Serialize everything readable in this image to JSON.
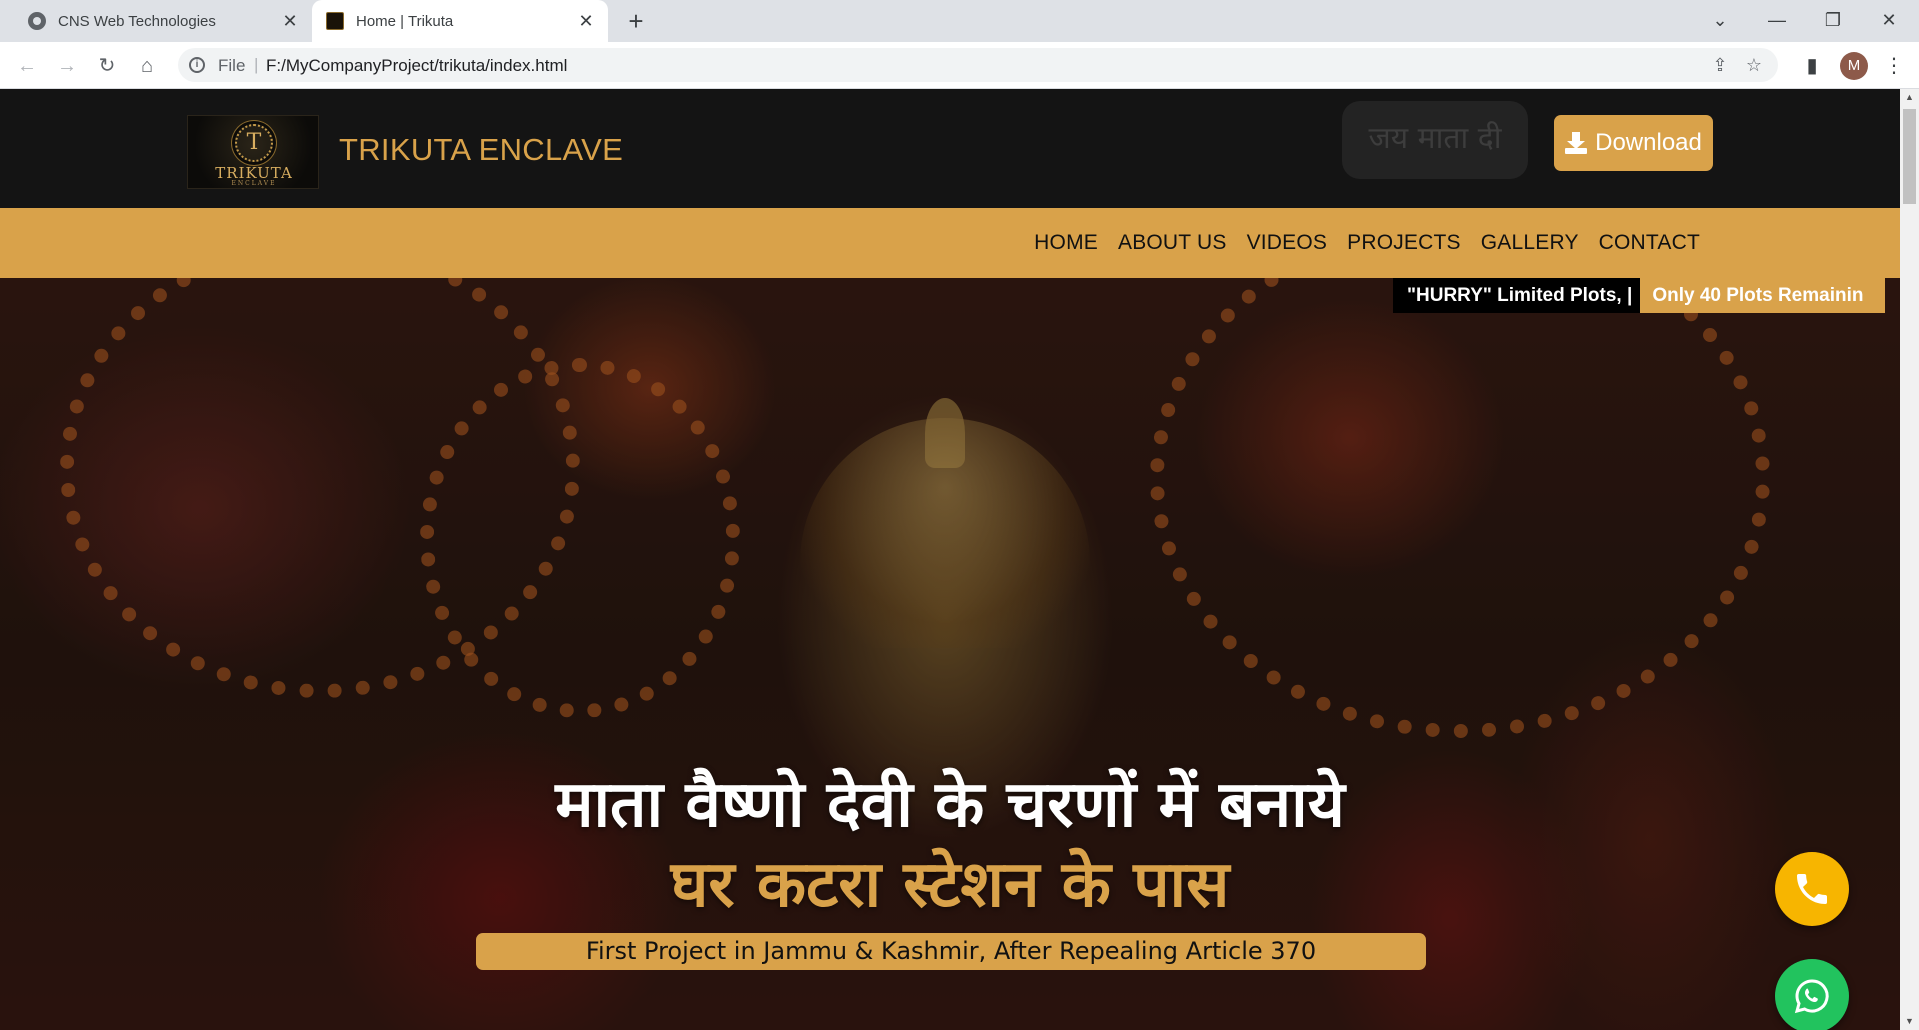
{
  "browser": {
    "tabs": [
      {
        "title": "CNS Web Technologies",
        "active": false
      },
      {
        "title": "Home | Trikuta",
        "active": true
      }
    ],
    "new_tab_label": "+",
    "address": {
      "scheme_label": "File",
      "separator": "|",
      "url": "F:/MyCompanyProject/trikuta/index.html"
    },
    "profile_initial": "M"
  },
  "site": {
    "logo": {
      "letter": "T",
      "text": "TRIKUTA",
      "subtext": "ENCLAVE"
    },
    "name": "TRIKUTA ENCLAVE",
    "greeting": "जय माता दी",
    "download_label": "Download",
    "nav": [
      "HOME",
      "ABOUT US",
      "VIDEOS",
      "PROJECTS",
      "GALLERY",
      "CONTACT"
    ],
    "ticker": {
      "lead": "\"HURRY\" Limited Plots, |",
      "message": "Only 40 Plots Remainin"
    },
    "hero": {
      "line1": "माता वैष्णो देवी के चरणों में बनाये",
      "line2": "घर कटरा स्टेशन के पास",
      "tagline": "First Project in Jammu & Kashmir, After Repealing Article 370"
    },
    "floating_buttons": [
      {
        "name": "call",
        "icon": "phone-icon"
      },
      {
        "name": "whatsapp",
        "icon": "whatsapp-icon"
      }
    ]
  },
  "colors": {
    "brand_gold": "#d9a24a",
    "header_bg": "#141414",
    "call_button": "#f7b500",
    "whatsapp_button": "#22c35e"
  }
}
